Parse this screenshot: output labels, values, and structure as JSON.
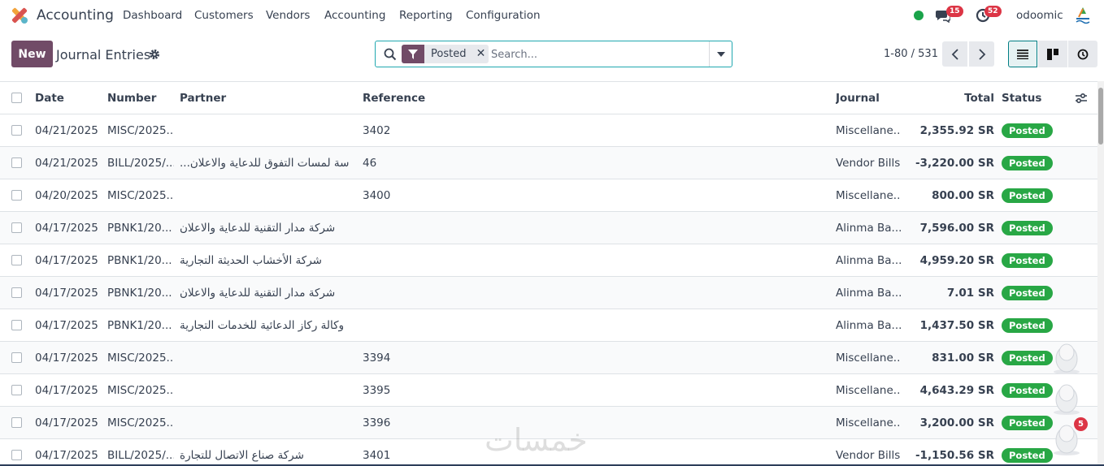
{
  "app": {
    "name": "Accounting",
    "logo_icon": "accounting-app-icon"
  },
  "menu": [
    {
      "label": "Dashboard"
    },
    {
      "label": "Customers"
    },
    {
      "label": "Vendors"
    },
    {
      "label": "Accounting"
    },
    {
      "label": "Reporting"
    },
    {
      "label": "Configuration"
    }
  ],
  "systray": {
    "messages_count": "15",
    "activities_count": "52",
    "company": "odoomic",
    "status_color": "#1aa34a"
  },
  "control": {
    "new_label": "New",
    "title": "Journal Entries",
    "facet_label": "Posted",
    "search_placeholder": "Search...",
    "pager": "1-80 / 531"
  },
  "colors": {
    "brand": "#714b67",
    "posted": "#28a745",
    "accent": "#017e84"
  },
  "table": {
    "headers": {
      "date": "Date",
      "number": "Number",
      "partner": "Partner",
      "reference": "Reference",
      "journal": "Journal",
      "total": "Total",
      "status": "Status"
    },
    "rows": [
      {
        "date": "04/21/2025",
        "number": "MISC/2025...",
        "partner": "",
        "reference": "3402",
        "journal": "Miscellane...",
        "total": "2,355.92 SR",
        "status": "Posted"
      },
      {
        "date": "04/21/2025",
        "number": "BILL/2025/...",
        "partner": "...سة لمسات التفوق للدعاية والاعلان",
        "reference": "46",
        "journal": "Vendor Bills",
        "total": "-3,220.00 SR",
        "status": "Posted"
      },
      {
        "date": "04/20/2025",
        "number": "MISC/2025...",
        "partner": "",
        "reference": "3400",
        "journal": "Miscellane...",
        "total": "800.00 SR",
        "status": "Posted"
      },
      {
        "date": "04/17/2025",
        "number": "PBNK1/20...",
        "partner": "شركة مدار التقنية للدعاية والاعلان",
        "reference": "",
        "journal": "Alinma Ba...",
        "total": "7,596.00 SR",
        "status": "Posted"
      },
      {
        "date": "04/17/2025",
        "number": "PBNK1/20...",
        "partner": "شركة الأخشاب الحديثة التجارية",
        "reference": "",
        "journal": "Alinma Ba...",
        "total": "4,959.20 SR",
        "status": "Posted"
      },
      {
        "date": "04/17/2025",
        "number": "PBNK1/20...",
        "partner": "شركة مدار التقنية للدعاية والاعلان",
        "reference": "",
        "journal": "Alinma Ba...",
        "total": "7.01 SR",
        "status": "Posted"
      },
      {
        "date": "04/17/2025",
        "number": "PBNK1/20...",
        "partner": "وكالة ركاز الدعائية للخدمات التجارية",
        "reference": "",
        "journal": "Alinma Ba...",
        "total": "1,437.50 SR",
        "status": "Posted"
      },
      {
        "date": "04/17/2025",
        "number": "MISC/2025...",
        "partner": "",
        "reference": "3394",
        "journal": "Miscellane...",
        "total": "831.00 SR",
        "status": "Posted"
      },
      {
        "date": "04/17/2025",
        "number": "MISC/2025...",
        "partner": "",
        "reference": "3395",
        "journal": "Miscellane...",
        "total": "4,643.29 SR",
        "status": "Posted"
      },
      {
        "date": "04/17/2025",
        "number": "MISC/2025...",
        "partner": "",
        "reference": "3396",
        "journal": "Miscellane...",
        "total": "3,200.00 SR",
        "status": "Posted"
      },
      {
        "date": "04/17/2025",
        "number": "BILL/2025/...",
        "partner": "شركة صناع الاتصال للتجارة",
        "reference": "3401",
        "journal": "Vendor Bills",
        "total": "-1,150.56 SR",
        "status": "Posted"
      }
    ]
  },
  "overlay": {
    "chat_badge": "5",
    "watermark": "خمسات"
  }
}
